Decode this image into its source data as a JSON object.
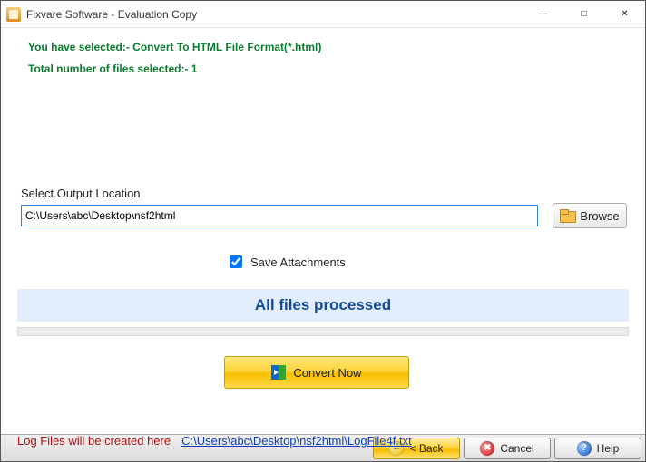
{
  "window": {
    "title": "Fixvare Software - Evaluation Copy"
  },
  "messages": {
    "selected_format": "You have selected:- Convert To HTML File Format(*.html)",
    "total_files": "Total number of files selected:- 1"
  },
  "output": {
    "label": "Select Output Location",
    "path_value": "C:\\Users\\abc\\Desktop\\nsf2html",
    "browse_label": "Browse"
  },
  "options": {
    "save_attachments_label": "Save Attachments",
    "save_attachments_checked": true
  },
  "status": {
    "text": "All files processed"
  },
  "actions": {
    "convert_label": "Convert Now"
  },
  "logs": {
    "label": "Log Files will be created here",
    "link_text": "C:\\Users\\abc\\Desktop\\nsf2html\\LogFile4f.txt"
  },
  "buttons": {
    "back": "< Back",
    "cancel": "Cancel",
    "help": "Help"
  }
}
